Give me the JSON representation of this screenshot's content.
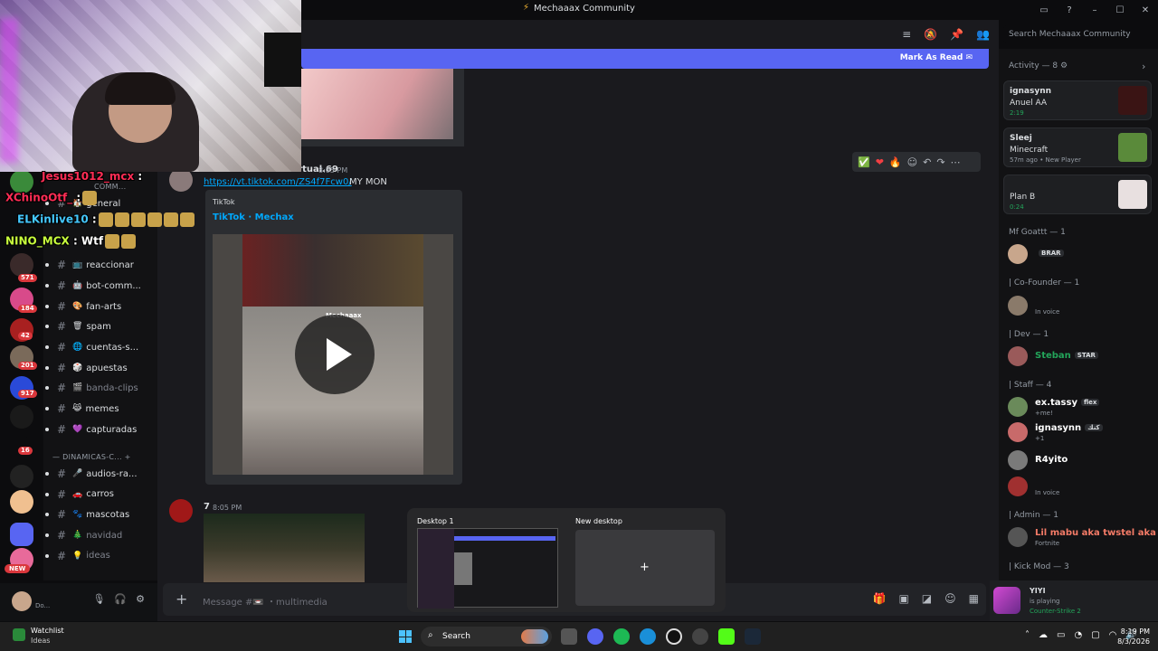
{
  "window": {
    "title": "Mechaaax Community"
  },
  "header": {
    "search_placeholder": "Search Mechaaax Community",
    "mark_as_read": "Mark As Read"
  },
  "stream_chat": [
    {
      "user": "Jesus1012_mcx",
      "text": ":",
      "color": "#ff2d55"
    },
    {
      "user": "XChinoOtf_",
      "text": ":",
      "color": "#ff2d55"
    },
    {
      "user": "ELKinlive10",
      "text": ":",
      "color": "#45c9ff"
    },
    {
      "user": "NINO_MCX",
      "text": ": Wtf",
      "color": "#c9ff3d"
    }
  ],
  "sidebar": {
    "category_top": "COMM...",
    "channels": [
      {
        "name": "general",
        "emoji": "🏠",
        "muted": false
      },
      {
        "name": "reaccionar",
        "emoji": "📺",
        "muted": false
      },
      {
        "name": "bot-comm...",
        "emoji": "🤖",
        "muted": false
      },
      {
        "name": "fan-arts",
        "emoji": "🎨",
        "muted": false
      },
      {
        "name": "spam",
        "emoji": "🗑",
        "muted": false
      },
      {
        "name": "cuentas-s...",
        "emoji": "🌐",
        "muted": false
      },
      {
        "name": "apuestas",
        "emoji": "🎲",
        "muted": false
      },
      {
        "name": "banda-clips",
        "emoji": "🎬",
        "muted": true
      },
      {
        "name": "memes",
        "emoji": "😹",
        "muted": false
      },
      {
        "name": "capturadas",
        "emoji": "💜",
        "muted": false
      }
    ],
    "category_dinamicas": "DINAMICAS-C...",
    "channels2": [
      {
        "name": "audios-ra...",
        "emoji": "🎤",
        "muted": false
      },
      {
        "name": "carros",
        "emoji": "🚗",
        "muted": false
      },
      {
        "name": "mascotas",
        "emoji": "🐾",
        "muted": false
      },
      {
        "name": "navidad",
        "emoji": "🎄",
        "muted": true
      },
      {
        "name": "ideas",
        "emoji": "💡",
        "muted": true
      }
    ]
  },
  "servers": {
    "badges": [
      "571",
      "184",
      "42",
      "201",
      "917",
      "16"
    ],
    "new_label": "NEW"
  },
  "messages": {
    "m1": {
      "author": "Mechaxacosadorvirtual.69",
      "time": "8:05 PM",
      "link": "https://vt.tiktok.com/ZS4f7Fcw0/",
      "text": "MY MON",
      "embed_provider": "TikTok",
      "embed_title": "TikTok · Mechax",
      "watermark": "Mechaaax"
    },
    "m2": {
      "author": "7",
      "time": "8:05 PM"
    }
  },
  "composer": {
    "placeholder": "Message #📼 ・multimedia"
  },
  "user_panel": {
    "name": "",
    "status": "Do..."
  },
  "activity": {
    "header": "Activity — 8",
    "cards": [
      {
        "user": "ignasynn",
        "title": "Anuel AA",
        "detail": "2:19",
        "detail_color": "#23a55a",
        "thumb": "#3a1414"
      },
      {
        "user": "Sleej",
        "title": "Minecraft",
        "detail": "57m ago • New Player",
        "detail_color": "#949ba4",
        "thumb": "#5a8a3a"
      },
      {
        "user": "",
        "title": "Plan B",
        "detail": "0:24",
        "detail_color": "#23a55a",
        "thumb": "#e8e0e0"
      }
    ]
  },
  "members": {
    "roles": {
      "mf": "Mf Goattt — 1",
      "cofounder": "| Co-Founder — 1",
      "dev": "| Dev — 1",
      "staff": "| Staff — 4",
      "admin": "| Admin — 1",
      "kickmod": "| Kick Mod — 3"
    },
    "list": [
      {
        "name": "",
        "tag": "BRAR",
        "sub": "",
        "color": "#dbdee1"
      },
      {
        "name": "",
        "tag": "",
        "sub": "In voice",
        "color": "#dbdee1"
      },
      {
        "name": "Steban",
        "tag": "STAR",
        "sub": "",
        "color": "#23a55a"
      },
      {
        "name": "ex.tassy",
        "tag": "flex",
        "sub": "+me!",
        "color": "#ffffff"
      },
      {
        "name": "ignasynn",
        "tag": "كنك",
        "sub": "+1",
        "color": "#ffffff"
      },
      {
        "name": "R4yito",
        "tag": "",
        "sub": "",
        "color": "#ffffff"
      },
      {
        "name": "",
        "tag": "",
        "sub": "In voice",
        "color": "#dbdee1"
      },
      {
        "name": "Lil mabu aka twstel aka b...",
        "tag": "",
        "sub": "Fortnite",
        "color": "#f47b67"
      }
    ]
  },
  "now_playing": {
    "name": "YIYI",
    "status": "is playing",
    "game": "Counter-Strike 2"
  },
  "taskview": {
    "desktop1": "Desktop 1",
    "new_desktop": "New desktop",
    "plus": "+"
  },
  "taskbar": {
    "watchlist": "Watchlist",
    "watchlist_sub": "Ideas",
    "search": "Search",
    "time": "8:19 PM",
    "date": "8/3/2026"
  }
}
